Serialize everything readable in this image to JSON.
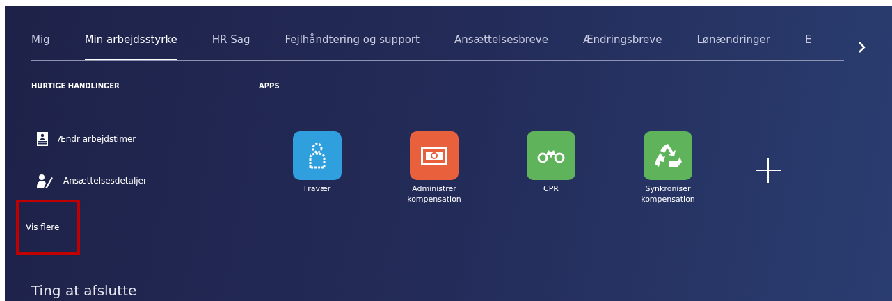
{
  "tabs": [
    {
      "label": "Mig",
      "selected": false
    },
    {
      "label": "Min arbejdsstyrke",
      "selected": true
    },
    {
      "label": "HR Sag",
      "selected": false
    },
    {
      "label": "Fejlhåndtering og support",
      "selected": false
    },
    {
      "label": "Ansættelsesbreve",
      "selected": false
    },
    {
      "label": "Ændringsbreve",
      "selected": false
    },
    {
      "label": "Lønændringer",
      "selected": false
    },
    {
      "label": "E",
      "selected": false
    }
  ],
  "quick_actions": {
    "heading": "HURTIGE HANDLINGER",
    "items": [
      {
        "label": "Ændr arbejdstimer",
        "kind": "badge"
      },
      {
        "label": "Ansættelsesdetaljer",
        "kind": "edit"
      }
    ],
    "show_more": {
      "label": "Vis flere",
      "highlighted": true
    }
  },
  "apps": {
    "heading": "APPS",
    "items": [
      {
        "label": "Fravær",
        "kind": "person",
        "color": "#2f9fde"
      },
      {
        "label": "Administrer kompensation",
        "kind": "money",
        "color": "#e8603c"
      },
      {
        "label": "CPR",
        "kind": "binoculars",
        "color": "#5fb35a"
      },
      {
        "label": "Synkroniser kompensation",
        "kind": "recycle",
        "color": "#5fb35a"
      }
    ]
  },
  "section_title": "Ting at afslutte"
}
